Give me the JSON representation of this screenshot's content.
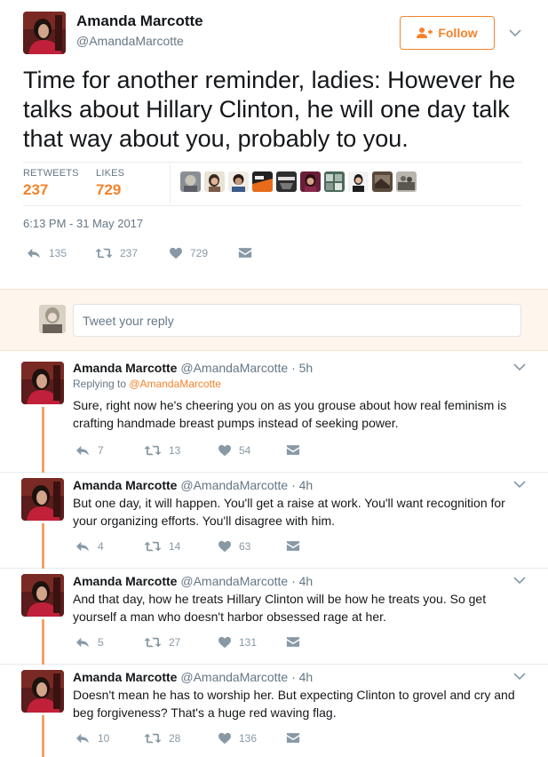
{
  "colors": {
    "accent": "#f5822a",
    "muted": "#657786",
    "icon": "#8899a6",
    "thread_line": "#f5a06a",
    "reply_bg": "#fef5ed"
  },
  "main": {
    "display_name": "Amanda Marcotte",
    "screen_name": "@AmandaMarcotte",
    "follow_label": "Follow",
    "text": "Time for another reminder, ladies: However he talks about Hillary Clinton, he will one day talk that way about you, probably to you.",
    "retweets_label": "RETWEETS",
    "retweets_count": "237",
    "likes_label": "LIKES",
    "likes_count": "729",
    "timestamp": "6:13 PM - 31 May 2017",
    "actions": {
      "reply": "135",
      "retweet": "237",
      "like": "729"
    }
  },
  "reply_box": {
    "placeholder": "Tweet your reply"
  },
  "thread": [
    {
      "name": "Amanda Marcotte",
      "handle": "@AmandaMarcotte",
      "time": "· 5h",
      "replying_prefix": "Replying to ",
      "replying_to": "@AmandaMarcotte",
      "text": "Sure, right now he's cheering you on as you grouse about how real feminism is crafting handmade breast pumps instead of seeking power.",
      "reply": "7",
      "retweet": "13",
      "like": "54"
    },
    {
      "name": "Amanda Marcotte",
      "handle": "@AmandaMarcotte",
      "time": "· 4h",
      "text": "But one day, it will happen. You'll get a raise at work. You'll want recognition for your organizing efforts. You'll disagree with him.",
      "reply": "4",
      "retweet": "14",
      "like": "63"
    },
    {
      "name": "Amanda Marcotte",
      "handle": "@AmandaMarcotte",
      "time": "· 4h",
      "text": "And that day, how he treats Hillary Clinton will be how he treats you. So get yourself a man who doesn't harbor obsessed rage at her.",
      "reply": "5",
      "retweet": "27",
      "like": "131"
    },
    {
      "name": "Amanda Marcotte",
      "handle": "@AmandaMarcotte",
      "time": "· 4h",
      "text": "Doesn't mean he has to worship her. But expecting Clinton to grovel and cry and beg forgiveness? That's a huge red waving flag.",
      "reply": "10",
      "retweet": "28",
      "like": "136"
    }
  ]
}
